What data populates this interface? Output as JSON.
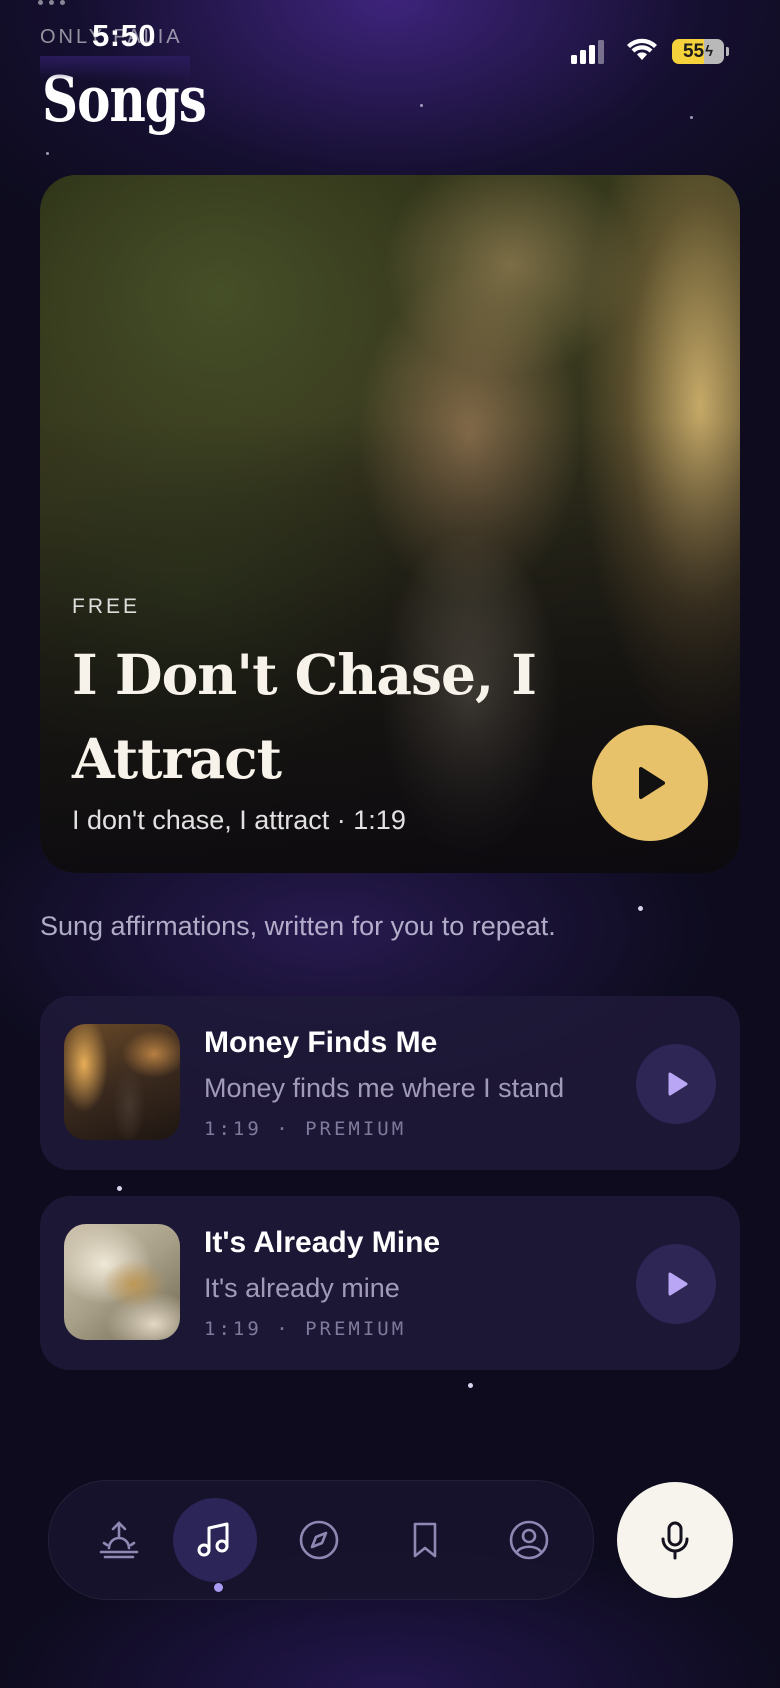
{
  "status_bar": {
    "time": "5:50",
    "carrier": "ONLY FALIA",
    "battery": "55"
  },
  "app": {
    "logo": "Songs"
  },
  "featured": {
    "tag": "FREE",
    "title": "I Don't Chase, I Attract",
    "subtitle": "I don't chase, I attract · 1:19",
    "play_icon": "play-icon"
  },
  "tagline": "Sung affirmations, written for you to repeat.",
  "tracks": [
    {
      "title": "Money Finds Me",
      "subtitle": "Money finds me where I stand",
      "meta": "1:19 · PREMIUM"
    },
    {
      "title": "It's Already Mine",
      "subtitle": "It's already mine",
      "meta": "1:19 · PREMIUM"
    }
  ],
  "nav": {
    "items": [
      {
        "icon": "sunrise-icon",
        "active": false
      },
      {
        "icon": "music-note-icon",
        "active": true
      },
      {
        "icon": "compass-icon",
        "active": false
      },
      {
        "icon": "bookmark-icon",
        "active": false
      },
      {
        "icon": "profile-icon",
        "active": false
      }
    ],
    "mic_icon": "microphone-icon"
  },
  "colors": {
    "accent_gold": "#e8c26a",
    "accent_purple": "#a99bf2",
    "background": "#0d0b1d"
  }
}
